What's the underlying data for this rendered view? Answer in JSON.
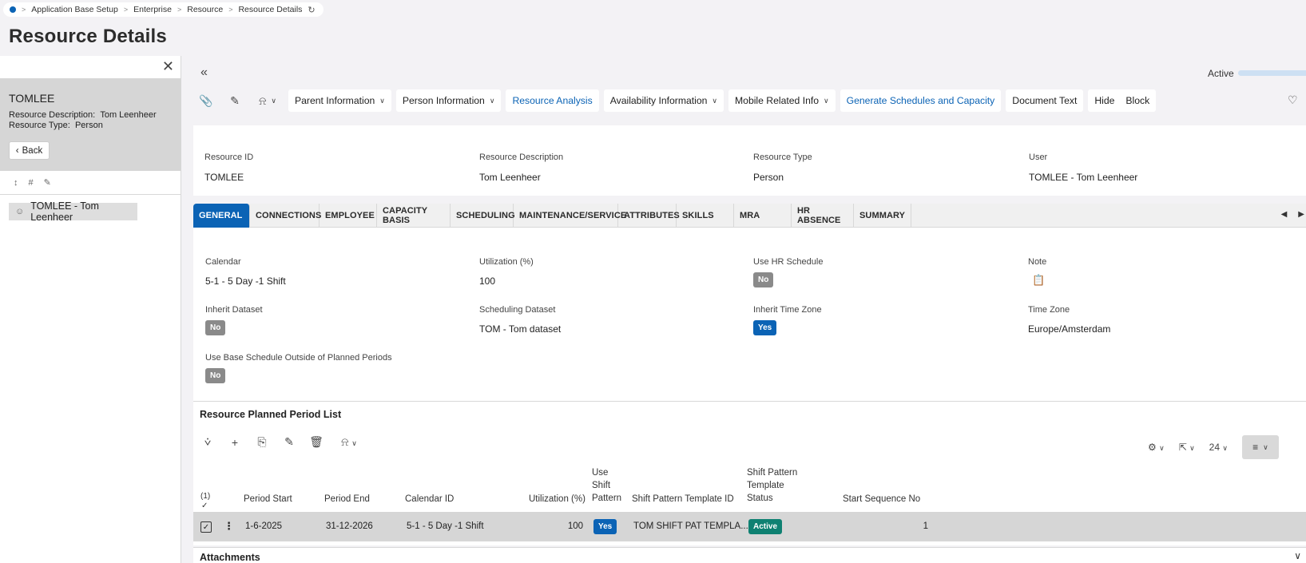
{
  "breadcrumb": [
    "Application Base Setup",
    "Enterprise",
    "Resource",
    "Resource Details"
  ],
  "page_title": "Resource Details",
  "left_panel": {
    "name": "TOMLEE",
    "description_label": "Resource Description:",
    "description_value": "Tom Leenheer",
    "type_label": "Resource Type:",
    "type_value": "Person",
    "back_label": "Back",
    "item_label": "TOMLEE - Tom Leenheer"
  },
  "status": {
    "label": "Active"
  },
  "toolbar": {
    "parent_info": "Parent Information",
    "person_info": "Person Information",
    "resource_analysis": "Resource Analysis",
    "availability_info": "Availability Information",
    "mobile_info": "Mobile Related Info",
    "generate": "Generate Schedules and Capacity",
    "document_text": "Document Text",
    "hide": "Hide",
    "block": "Block"
  },
  "header": {
    "resource_id_label": "Resource ID",
    "resource_id_value": "TOMLEE",
    "desc_label": "Resource Description",
    "desc_value": "Tom Leenheer",
    "type_label": "Resource Type",
    "type_value": "Person",
    "user_label": "User",
    "user_value": "TOMLEE - Tom Leenheer"
  },
  "tabs": [
    "GENERAL",
    "CONNECTIONS",
    "EMPLOYEE",
    "CAPACITY BASIS",
    "SCHEDULING",
    "MAINTENANCE/SERVICE",
    "ATTRIBUTES",
    "SKILLS",
    "MRA",
    "HR ABSENCE",
    "SUMMARY"
  ],
  "general": {
    "calendar_label": "Calendar",
    "calendar_value": "5-1 - 5 Day -1 Shift",
    "utilization_label": "Utilization (%)",
    "utilization_value": "100",
    "use_hr_label": "Use HR Schedule",
    "use_hr_value": "No",
    "note_label": "Note",
    "inherit_dataset_label": "Inherit Dataset",
    "inherit_dataset_value": "No",
    "sched_dataset_label": "Scheduling Dataset",
    "sched_dataset_value": "TOM - Tom dataset",
    "inherit_tz_label": "Inherit Time Zone",
    "inherit_tz_value": "Yes",
    "tz_label": "Time Zone",
    "tz_value": "Europe/Amsterdam",
    "use_base_label": "Use Base Schedule Outside of Planned Periods",
    "use_base_value": "No"
  },
  "list": {
    "title": "Resource Planned Period List",
    "page_size": "24",
    "count": "(1)",
    "columns": {
      "period_start": "Period Start",
      "period_end": "Period End",
      "calendar_id": "Calendar ID",
      "utilization": "Utilization (%)",
      "use_shift_1": "Use",
      "use_shift_2": "Shift",
      "use_shift_3": "Pattern",
      "template_id": "Shift Pattern Template ID",
      "status_1": "Shift Pattern",
      "status_2": "Template",
      "status_3": "Status",
      "start_seq": "Start Sequence No"
    },
    "row": {
      "period_start": "1-6-2025",
      "period_end": "31-12-2026",
      "calendar_id": "5-1 - 5 Day -1 Shift",
      "utilization": "100",
      "use_shift": "Yes",
      "template_id": "TOM SHIFT PAT TEMPLA...",
      "status": "Active",
      "start_seq": "1"
    }
  },
  "attachments": {
    "title": "Attachments"
  }
}
